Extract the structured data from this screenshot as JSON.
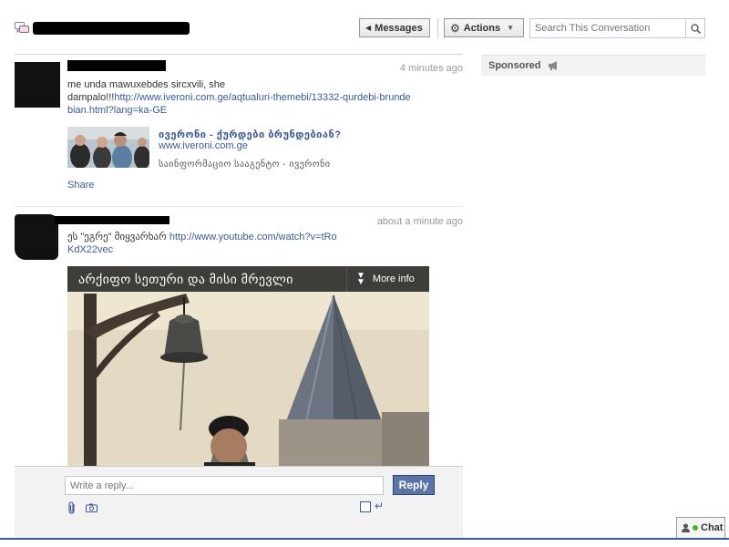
{
  "header": {
    "messages_label": "Messages",
    "actions_label": "Actions",
    "search_placeholder": "Search This Conversation"
  },
  "messages": [
    {
      "time": "4 minutes ago",
      "text_line1": "me unda mawuxebdes sircxvili, she",
      "text_prefix": "dampalo!!!",
      "link": "http://www.iveroni.com.ge/aqtualuri-themebi/13332-qurdebi-brundebian.html?lang=ka-GE",
      "attachment": {
        "title": "ივერონი - ქურდები ბრუნდებიან?",
        "url": "www.iveroni.com.ge",
        "description": "საინფორმაციო სააგენტო - ივერონი"
      },
      "share_label": "Share"
    },
    {
      "time": "about a minute ago",
      "text_prefix": "ეს \"ეგრე\" მიყვარხარ ",
      "link": "http://www.youtube.com/watch?v=tRoKdX22vec",
      "video": {
        "title": "არქიფო სეთური და მისი მრევლი",
        "more_info": "More info"
      }
    }
  ],
  "composer": {
    "placeholder": "Write a reply...",
    "reply_label": "Reply",
    "enter_glyph": "↵"
  },
  "sidebar": {
    "sponsored_label": "Sponsored"
  },
  "chat": {
    "label": "Chat"
  },
  "colors": {
    "link": "#3b5998",
    "reply_button": "#5b74a8",
    "online": "#42b72a"
  }
}
